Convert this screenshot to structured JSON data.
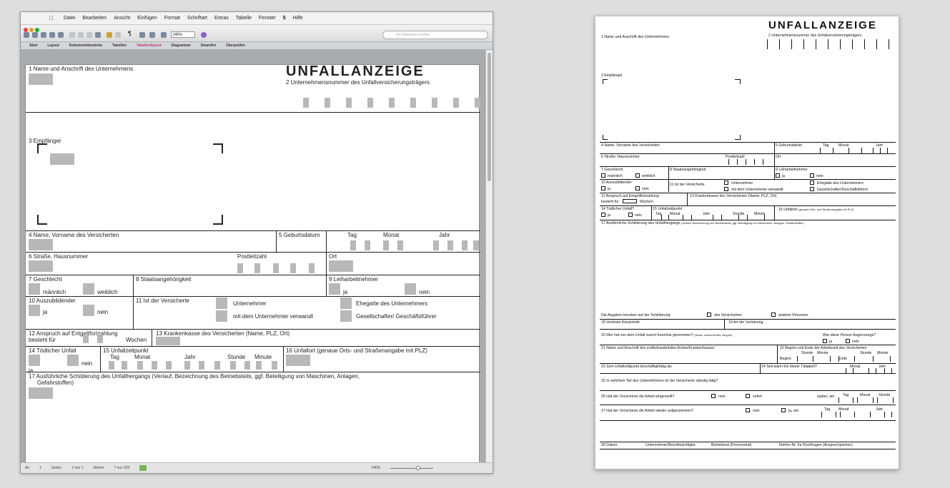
{
  "menu": {
    "app_icon": "apple-icon",
    "items": [
      "Datei",
      "Bearbeiten",
      "Ansicht",
      "Einfügen",
      "Format",
      "Schriftart",
      "Extras",
      "Tabelle",
      "Fenster",
      "$",
      "Hilfe"
    ]
  },
  "toolbar": {
    "zoom": "240%",
    "search_placeholder": "Im Dokument suchen"
  },
  "ribbon": {
    "tabs": [
      "Start",
      "Layout",
      "Dokumentelemente",
      "Tabellen",
      "Tabellenlayout",
      "Diagramme",
      "SmartArt",
      "Überprüfen"
    ],
    "active": "Tabellenlayout"
  },
  "status": {
    "ansicht": "An",
    "seite": "1",
    "seiten_label": "Seiten",
    "von": "1 von 1",
    "woerter_label": "Wörter",
    "woerter": "7 von 303",
    "zoom": "240%"
  },
  "doc": {
    "title": "UNFALLANZEIGE",
    "f1": "1 Name und Anschrift des Unternehmens",
    "f2": "2 Unternehmensnummer des Unfallversicherungsträgers",
    "f3": "3 Empfänger",
    "f4": "4 Name, Vorname des Versicherten",
    "f5": "5 Geburtsdatum",
    "tag": "Tag",
    "monat": "Monat",
    "jahr": "Jahr",
    "f6": "6 Straße, Hausnummer",
    "plz": "Postleitzahl",
    "ort": "Ort",
    "f7": "7 Geschlecht",
    "maennlich": "männlich",
    "weiblich": "weiblich",
    "f8": "8 Staatsangehörigkeit",
    "f9": "9 Leiharbeitnehmer",
    "ja": "ja",
    "nein": "nein",
    "f10": "10 Auszubildender",
    "f11": "11 Ist der Versicherte",
    "unternehmer": "Unternehmer",
    "mit_dem": "mit dem Unternehmer verwandt",
    "ehegatte": "Ehegatte des Unternehmers",
    "gesellschafter": "Gesellschafter/ Geschäftsführer",
    "f12": "12 Anspruch auf Entgeltfortzahlung",
    "besteht_fuer": "besteht für",
    "wochen": "Wochen",
    "f13": "13 Krankenkasse des Versicherten (Name, PLZ, Ort)",
    "f14": "14 Tödlicher Unfall",
    "f15": "15 Unfallzeitpunkt",
    "stunde": "Stunde",
    "minute": "Minute",
    "f16": "16 Unfallort (genaue Orts- und Straßenangabe mit PLZ)",
    "f17": "17 Ausführliche Schilderung des Unfallhergangs (Verlauf, Bezeichnung des Betriebsteils, ggf. Beteiligung von Maschinen, Anlagen,",
    "f17b": "Gefahrstoffen)"
  },
  "form": {
    "title": "UNFALLANZEIGE",
    "f1": "1 Name und Anschrift des Unternehmens",
    "f2": "2 Unternehmensnummer des Unfallversicherungsträgers",
    "f3": "3 Empfänger",
    "f4": "4 Name, Vorname des Versicherten",
    "f5": "5 Geburtsdatum",
    "tag": "Tag",
    "monat": "Monat",
    "jahr": "Jahr",
    "f6": "6 Straße, Hausnummer",
    "plz": "Postleitzahl",
    "ort": "Ort",
    "f7": "7 Geschlecht",
    "maennlich": "männlich",
    "weiblich": "weiblich",
    "f8": "8 Staatsangehörigkeit",
    "f9": "9 Leiharbeitnehmer",
    "ja": "ja",
    "nein": "nein",
    "f10": "10 Auszubildender",
    "f11": "11 Ist der Versicherte",
    "unternehmer": "Unternehmer",
    "mit_dem": "mit dem Unternehmer verwandt",
    "ehegatte": "Ehegatte des Unternehmers",
    "gesellschafter": "Gesellschafter/Geschäftsführer",
    "f12": "12 Anspruch auf Entgeltfortzahlung",
    "besteht_fuer": "besteht für",
    "wochen": "Wochen",
    "f13": "13 Krankenkasse des Versicherten (Name, PLZ, Ort)",
    "f14": "14 Tödlicher Unfall?",
    "f15": "15 Unfallzeitpunkt",
    "stunde": "Stunde",
    "minute": "Minute",
    "f16": "16 Unfallort",
    "f16_hint": "(genaue Orts- und Straßenangabe mit PLZ)",
    "f17": "17 Ausführliche Schilderung des Unfallhergangs",
    "f17_hint": "(Verlauf, Bezeichnung des Betriebsteils, ggf. Beteiligung von Maschinen, Anlagen, Gefahrstoffen)",
    "angaben": "Die Angaben beruhen auf der Schilderung",
    "des_vers": "des Versicherten",
    "anderer": "anderer Personen",
    "f18": "18 Verletzte Körperteile",
    "f19": "19 Art der Verletzung",
    "f20": "20 Wer hat von dem Unfall zuerst Kenntnis genommen?",
    "f20_hint": "(Name, Anschrift des Zeugen)",
    "f20_q": "War diese Person Augenzeuge?",
    "f21": "21 Name und Anschrift des erstbehandelnden Arztes/Krankenhauses",
    "f22": "22 Beginn und Ende der Arbeitszeit des Versicherten",
    "beginn": "Beginn",
    "ende": "Ende",
    "f23": "23 Zum Unfallzeitpunkt beschäftigt/tätig als",
    "f24": "24 Seit wann bei dieser Tätigkeit?",
    "f25": "25 In welchem Teil des Unternehmens ist der Versicherte ständig tätig?",
    "f26": "26 Hat der Versicherte die Arbeit eingestellt?",
    "sofort": "sofort",
    "spaeter": "später, am",
    "f27": "27 Hat der Versicherte die Arbeit wieder aufgenommen?",
    "ja_am": "ja, am",
    "f28": "28 Datum",
    "unternehmer_bev": "Unternehmer/Bevollmächtigter",
    "betriebsrat": "Betriebsrat (Personalrat)",
    "telefon": "Telefon-Nr. für Rückfragen (Ansprechpartner)"
  }
}
